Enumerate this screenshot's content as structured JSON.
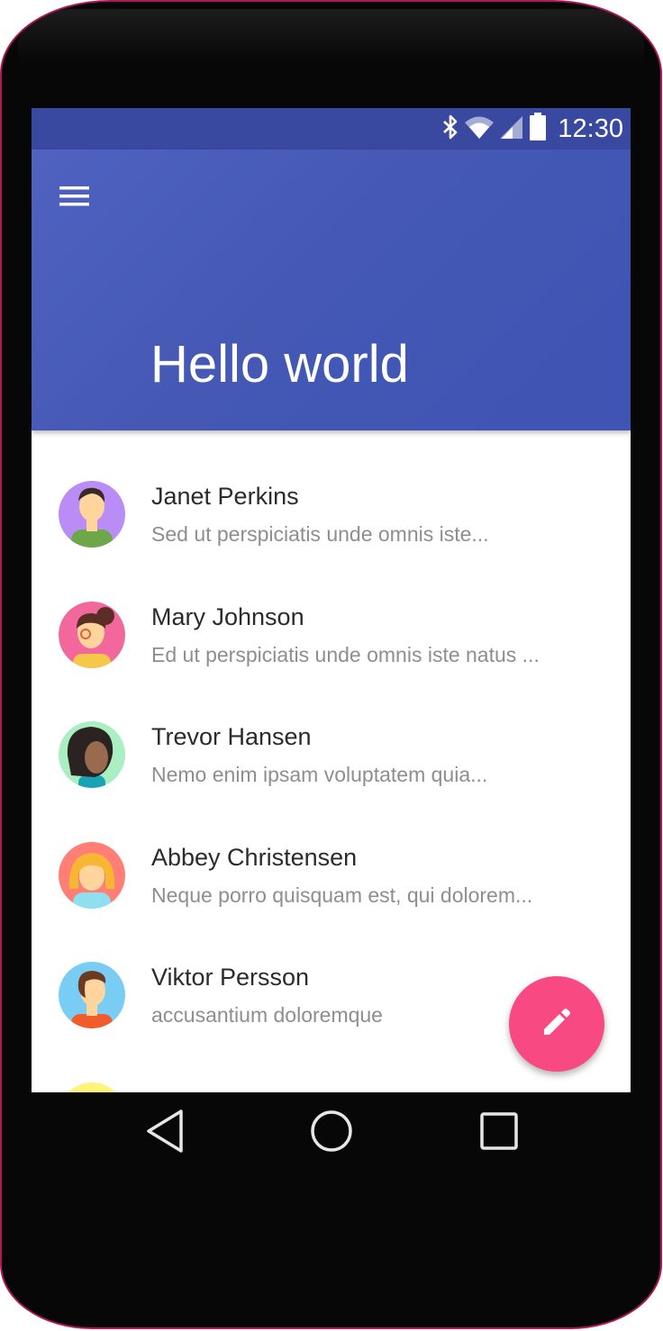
{
  "status_bar": {
    "time": "12:30",
    "icons": [
      "bluetooth-icon",
      "wifi-icon",
      "signal-icon",
      "battery-icon"
    ]
  },
  "app_bar": {
    "menu_icon": "menu-icon",
    "title": "Hello world"
  },
  "contacts": [
    {
      "name": "Janet Perkins",
      "preview": "Sed ut perspiciatis unde omnis iste...",
      "avatar_color": "#b98df5"
    },
    {
      "name": "Mary Johnson",
      "preview": "Ed ut perspiciatis unde omnis iste natus ...",
      "avatar_color": "#f2689c"
    },
    {
      "name": "Trevor Hansen",
      "preview": "Nemo enim ipsam voluptatem quia...",
      "avatar_color": "#a9efc1"
    },
    {
      "name": "Abbey Christensen",
      "preview": "Neque porro quisquam est, qui dolorem...",
      "avatar_color": "#ff7f77"
    },
    {
      "name": "Viktor Persson",
      "preview": "accusantium doloremque",
      "avatar_color": "#79ccf3"
    },
    {
      "name": "",
      "preview": "",
      "avatar_color": "#fff37a"
    }
  ],
  "fab": {
    "icon": "pencil-icon",
    "color": "#f94982"
  },
  "nav_bar": {
    "icons": [
      "back-icon",
      "home-icon",
      "recents-icon"
    ]
  },
  "colors": {
    "status_bar": "#3a49a0",
    "app_bar": "#4458b4",
    "accent": "#f94982",
    "device": "#070707"
  }
}
